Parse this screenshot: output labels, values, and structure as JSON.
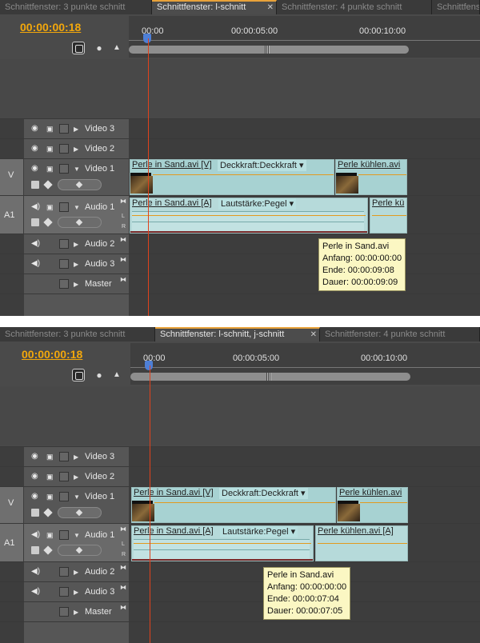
{
  "panels": [
    {
      "tabs": [
        "Schnittfenster: 3 punkte schnitt",
        "Schnittfenster: l-schnitt",
        "Schnittfenster: 4 punkte schnitt",
        "Schnittfenster"
      ],
      "active_tab": 1,
      "timecode": "00:00:00:18",
      "ruler": [
        "00:00",
        "00:00:05:00",
        "00:00:10:00"
      ],
      "tracks": {
        "video3": "Video 3",
        "video2": "Video 2",
        "video1": "Video 1",
        "audio1": "Audio 1",
        "audio2": "Audio 2",
        "audio3": "Audio 3",
        "master": "Master"
      },
      "targets": {
        "v": "V",
        "a": "A1"
      },
      "channels": {
        "l": "L",
        "r": "R"
      },
      "clips": {
        "video1_name": "Perle in Sand.avi [V]",
        "video1_effect": "Deckkraft:Deckkraft",
        "video2_name": "Perle kühlen.avi",
        "audio1_name": "Perle in Sand.avi [A]",
        "audio1_effect": "Lautstärke:Pegel",
        "audio2_name": "Perle kü"
      },
      "tooltip": [
        "Perle in Sand.avi",
        "Anfang: 00:00:00:00",
        "Ende: 00:00:09:08",
        "Dauer: 00:00:09:09"
      ]
    },
    {
      "tabs": [
        "Schnittfenster: 3 punkte schnitt",
        "Schnittfenster: l-schnitt, j-schnitt",
        "Schnittfenster: 4 punkte schnitt"
      ],
      "active_tab": 1,
      "timecode": "00:00:00:18",
      "ruler": [
        "00:00",
        "00:00:05:00",
        "00:00:10:00"
      ],
      "tracks": {
        "video3": "Video 3",
        "video2": "Video 2",
        "video1": "Video 1",
        "audio1": "Audio 1",
        "audio2": "Audio 2",
        "audio3": "Audio 3",
        "master": "Master"
      },
      "targets": {
        "v": "V",
        "a": "A1"
      },
      "channels": {
        "l": "L",
        "r": "R"
      },
      "clips": {
        "video1_name": "Perle in Sand.avi [V]",
        "video1_effect": "Deckkraft:Deckkraft",
        "video2_name": "Perle kühlen.avi",
        "audio1_name": "Perle in Sand.avi [A]",
        "audio1_effect": "Lautstärke:Pegel",
        "audio2_name": "Perle kühlen.avi [A]"
      },
      "tooltip": [
        "Perle in Sand.avi",
        "Anfang: 00:00:00:00",
        "Ende: 00:00:07:04",
        "Dauer: 00:00:07:05"
      ]
    }
  ]
}
